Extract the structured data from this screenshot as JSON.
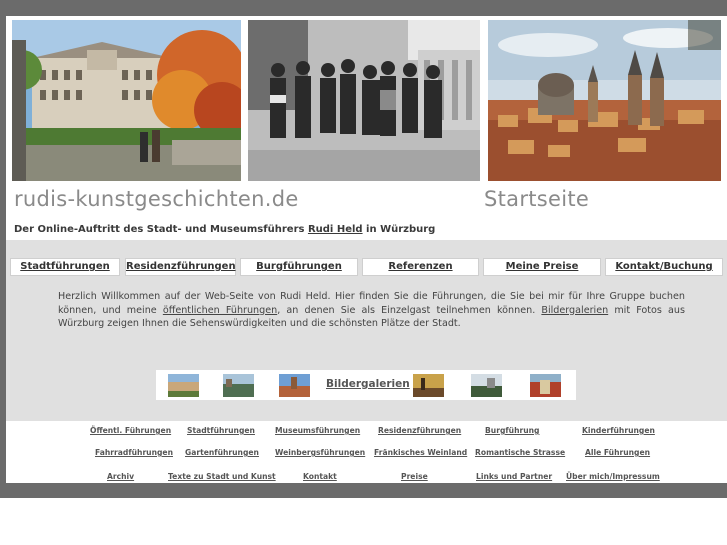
{
  "header": {
    "site_name": "rudis-kunstgeschichten.de",
    "page_title": "Startseite",
    "tagline_prefix": "Der Online-Auftritt des Stadt- und Museumsführers ",
    "tagline_link": "Rudi Held",
    "tagline_suffix": " in Würzburg"
  },
  "nav": {
    "items": [
      {
        "label": "Stadtführungen"
      },
      {
        "label": "Residenzführungen"
      },
      {
        "label": "Burgführungen"
      },
      {
        "label": "Referenzen"
      },
      {
        "label": "Meine Preise"
      },
      {
        "label": "Kontakt/Buchung"
      }
    ]
  },
  "welcome": {
    "part1": "Herzlich Willkommen auf der Web-Seite von Rudi Held. Hier finden Sie die Führungen, die Sie bei mir für Ihre Gruppe buchen können, und meine ",
    "link1": "öffentlichen Führungen",
    "part2": ", an denen Sie als Einzelgast teilnehmen können. ",
    "link2": "Bildergalerien",
    "part3": " mit Fotos aus Würzburg zeigen Ihnen die Sehenswürdigkeiten und die schönsten Plätze der Stadt."
  },
  "gallery": {
    "label": "Bildergalerien"
  },
  "footer": {
    "row1": [
      "Öffentl. Führungen",
      "Stadtführungen",
      "Museumsführungen",
      "Residenzführungen",
      "Burgführung",
      "Kinderführungen"
    ],
    "row2": [
      "Fahrradführungen",
      "Gartenführungen",
      "Weinbergsführungen",
      "Fränkisches Weinland",
      "Romantische Strasse",
      "Alle Führungen"
    ],
    "row3": [
      "Archiv",
      "Texte zu Stadt und Kunst",
      "Kontakt",
      "Preise",
      "Links und Partner",
      "Über mich/Impressum"
    ]
  },
  "colors": {
    "frame": "#6b6b6b",
    "panel": "#e0e0e0",
    "heading_grey": "#8a8a8a"
  }
}
